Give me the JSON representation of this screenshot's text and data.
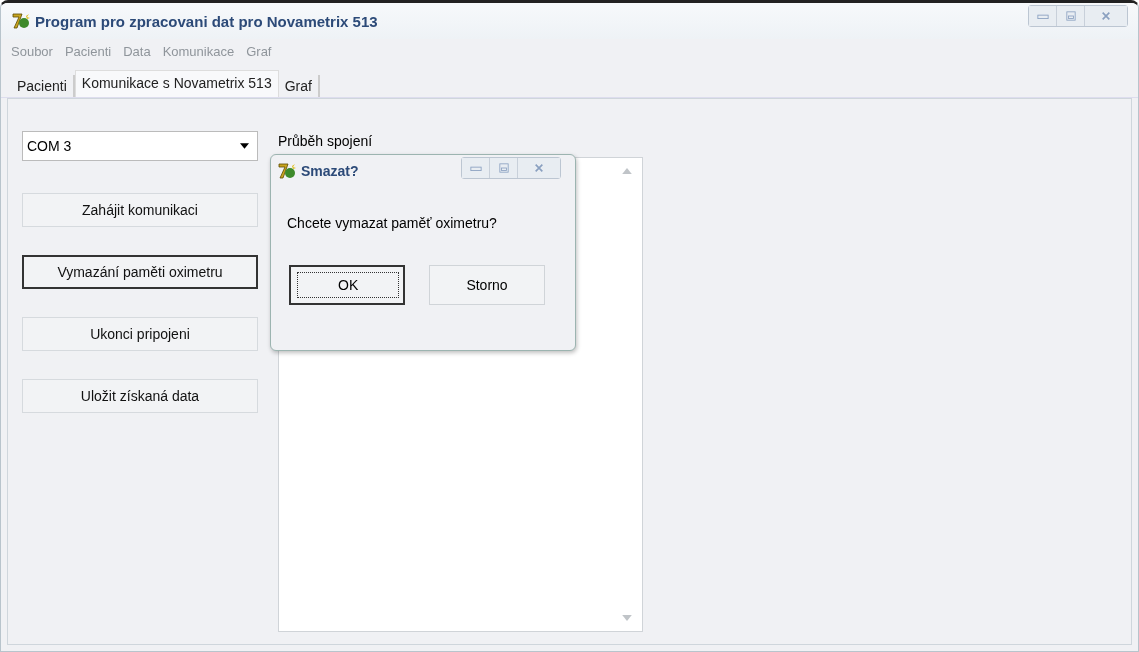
{
  "window": {
    "title": "Program pro zpracovani dat pro Novametrix 513"
  },
  "menu": [
    {
      "label": "Soubor",
      "disabled": true
    },
    {
      "label": "Pacienti",
      "disabled": true
    },
    {
      "label": "Data",
      "disabled": true
    },
    {
      "label": "Komunikace",
      "disabled": true
    },
    {
      "label": "Graf",
      "disabled": true
    }
  ],
  "tabs": [
    {
      "label": "Pacienti",
      "selected": false
    },
    {
      "label": "Komunikace s Novametrix 513",
      "selected": true
    },
    {
      "label": "Graf",
      "selected": false
    }
  ],
  "port": {
    "value": "COM 3"
  },
  "buttons": [
    {
      "label": "Zahájit komunikaci",
      "focused": false
    },
    {
      "label": "Vymazání paměti oximetru",
      "focused": true
    },
    {
      "label": "Ukonci pripojeni",
      "focused": false
    },
    {
      "label": "Uložit získaná data",
      "focused": false
    }
  ],
  "log": {
    "label": "Průběh spojení"
  },
  "dialog": {
    "title": "Smazat?",
    "message": "Chcete vymazat paměť oximetru?",
    "buttons": [
      {
        "label": "OK",
        "focused": true
      },
      {
        "label": "Storno",
        "focused": false
      }
    ]
  }
}
